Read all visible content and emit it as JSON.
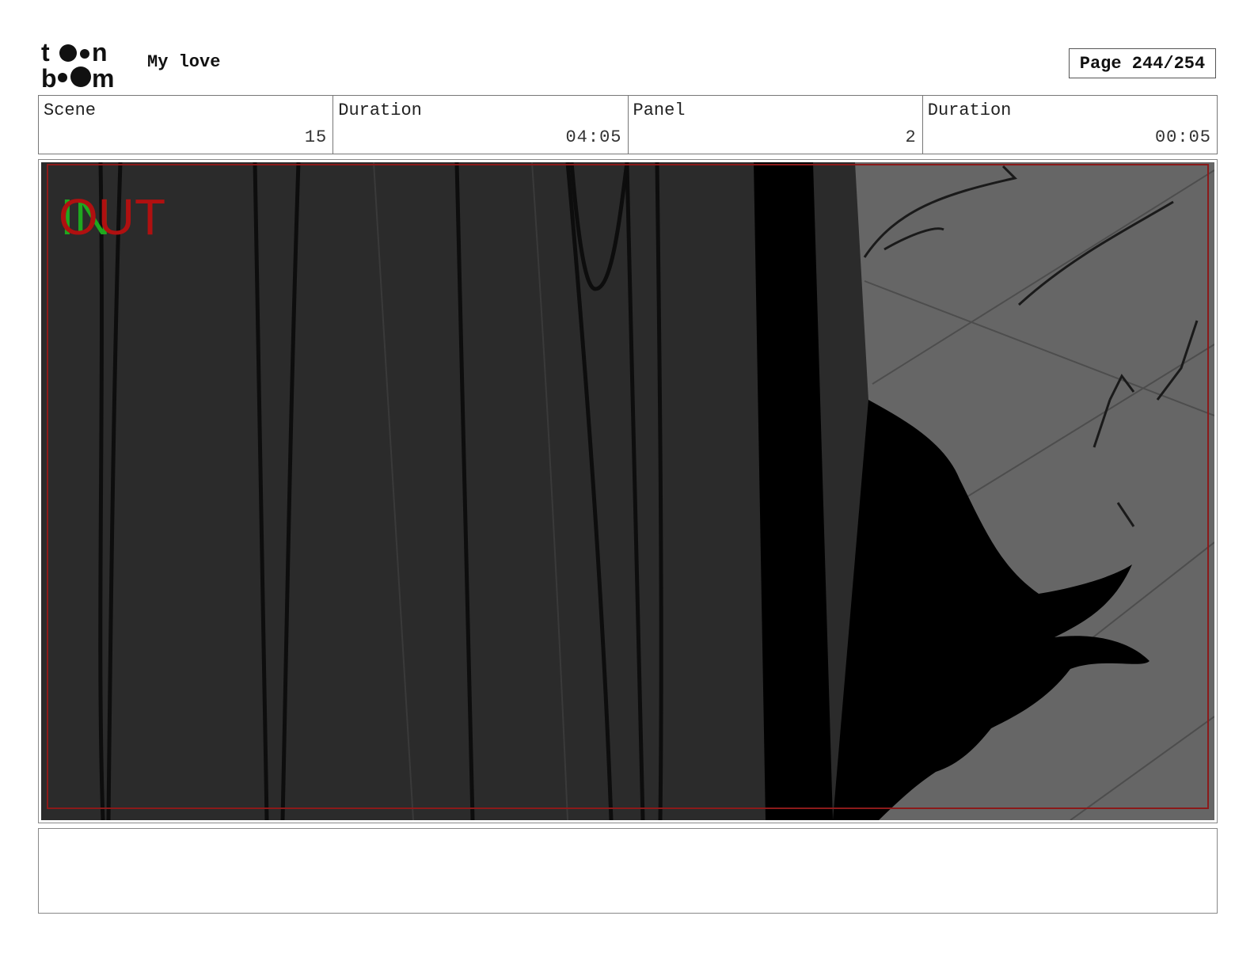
{
  "header": {
    "logo_top": "t••n",
    "logo_bottom": "b••m",
    "project_title": "My love",
    "page_label": "Page 244/254"
  },
  "info": {
    "scene_label": "Scene",
    "scene_value": "15",
    "scene_duration_label": "Duration",
    "scene_duration_value": "04:05",
    "panel_label": "Panel",
    "panel_value": "2",
    "panel_duration_label": "Duration",
    "panel_duration_value": "00:05"
  },
  "panel": {
    "in_marker": "IN",
    "out_marker": "OUT",
    "in_color": "#1fa81f",
    "out_color": "#b01010",
    "safe_frame_color": "#8b1a1a"
  },
  "notes": {
    "text": ""
  }
}
